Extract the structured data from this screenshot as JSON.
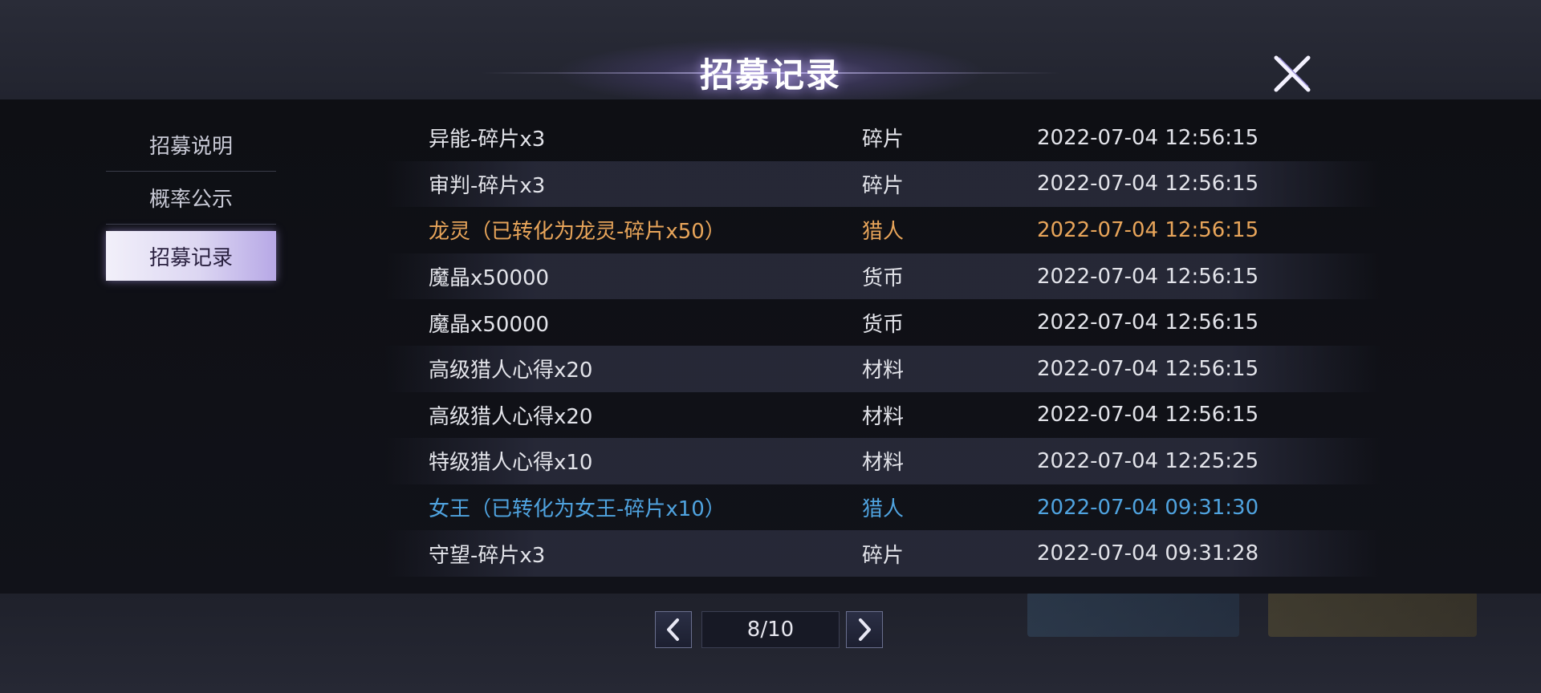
{
  "header": {
    "title": "招募记录"
  },
  "sidebar": {
    "items": [
      {
        "label": "招募说明",
        "active": false
      },
      {
        "label": "概率公示",
        "active": false
      },
      {
        "label": "招募记录",
        "active": true
      }
    ]
  },
  "records": [
    {
      "item": "异能-碎片x3",
      "type": "碎片",
      "time": "2022-07-04 12:56:15",
      "color": "#e3e4ea"
    },
    {
      "item": "审判-碎片x3",
      "type": "碎片",
      "time": "2022-07-04 12:56:15",
      "color": "#e3e4ea"
    },
    {
      "item": "龙灵（已转化为龙灵-碎片x50）",
      "type": "猎人",
      "time": "2022-07-04 12:56:15",
      "color": "#e8a55a"
    },
    {
      "item": "魔晶x50000",
      "type": "货币",
      "time": "2022-07-04 12:56:15",
      "color": "#e3e4ea"
    },
    {
      "item": "魔晶x50000",
      "type": "货币",
      "time": "2022-07-04 12:56:15",
      "color": "#e3e4ea"
    },
    {
      "item": "高级猎人心得x20",
      "type": "材料",
      "time": "2022-07-04 12:56:15",
      "color": "#e3e4ea"
    },
    {
      "item": "高级猎人心得x20",
      "type": "材料",
      "time": "2022-07-04 12:56:15",
      "color": "#e3e4ea"
    },
    {
      "item": "特级猎人心得x10",
      "type": "材料",
      "time": "2022-07-04 12:25:25",
      "color": "#e3e4ea"
    },
    {
      "item": "女王（已转化为女王-碎片x10）",
      "type": "猎人",
      "time": "2022-07-04 09:31:30",
      "color": "#4fa3df"
    },
    {
      "item": "守望-碎片x3",
      "type": "碎片",
      "time": "2022-07-04 09:31:28",
      "color": "#e3e4ea"
    }
  ],
  "pagination": {
    "indicator": "8/10",
    "current": 8,
    "total": 10
  },
  "icons": {
    "close": "close-x-icon",
    "prev": "chevron-left-icon",
    "next": "chevron-right-icon"
  }
}
